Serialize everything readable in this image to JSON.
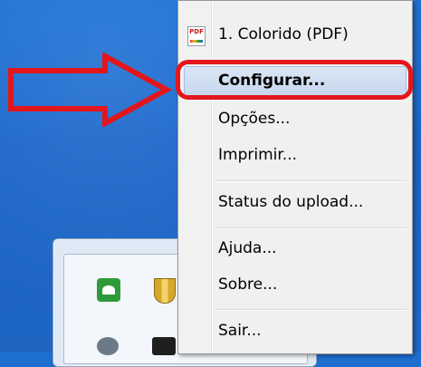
{
  "menu": {
    "items": [
      {
        "label": "1. Colorido (PDF)",
        "icon": "pdf-printer-icon"
      },
      {
        "label": "Configurar...",
        "highlighted": true,
        "bold": true
      },
      {
        "label": "Opções..."
      },
      {
        "label": "Imprimir..."
      },
      {
        "label": "Status do upload..."
      },
      {
        "label": "Ajuda..."
      },
      {
        "label": "Sobre..."
      },
      {
        "label": "Sair..."
      }
    ],
    "pdf_icon_text": "PDF"
  },
  "annotation": {
    "arrow_color": "#e3161b",
    "ring_color": "#e3161b"
  },
  "tray": {
    "icons": [
      "green-app-icon",
      "shield-icon",
      "eye-icon",
      "dark-app-icon"
    ]
  }
}
